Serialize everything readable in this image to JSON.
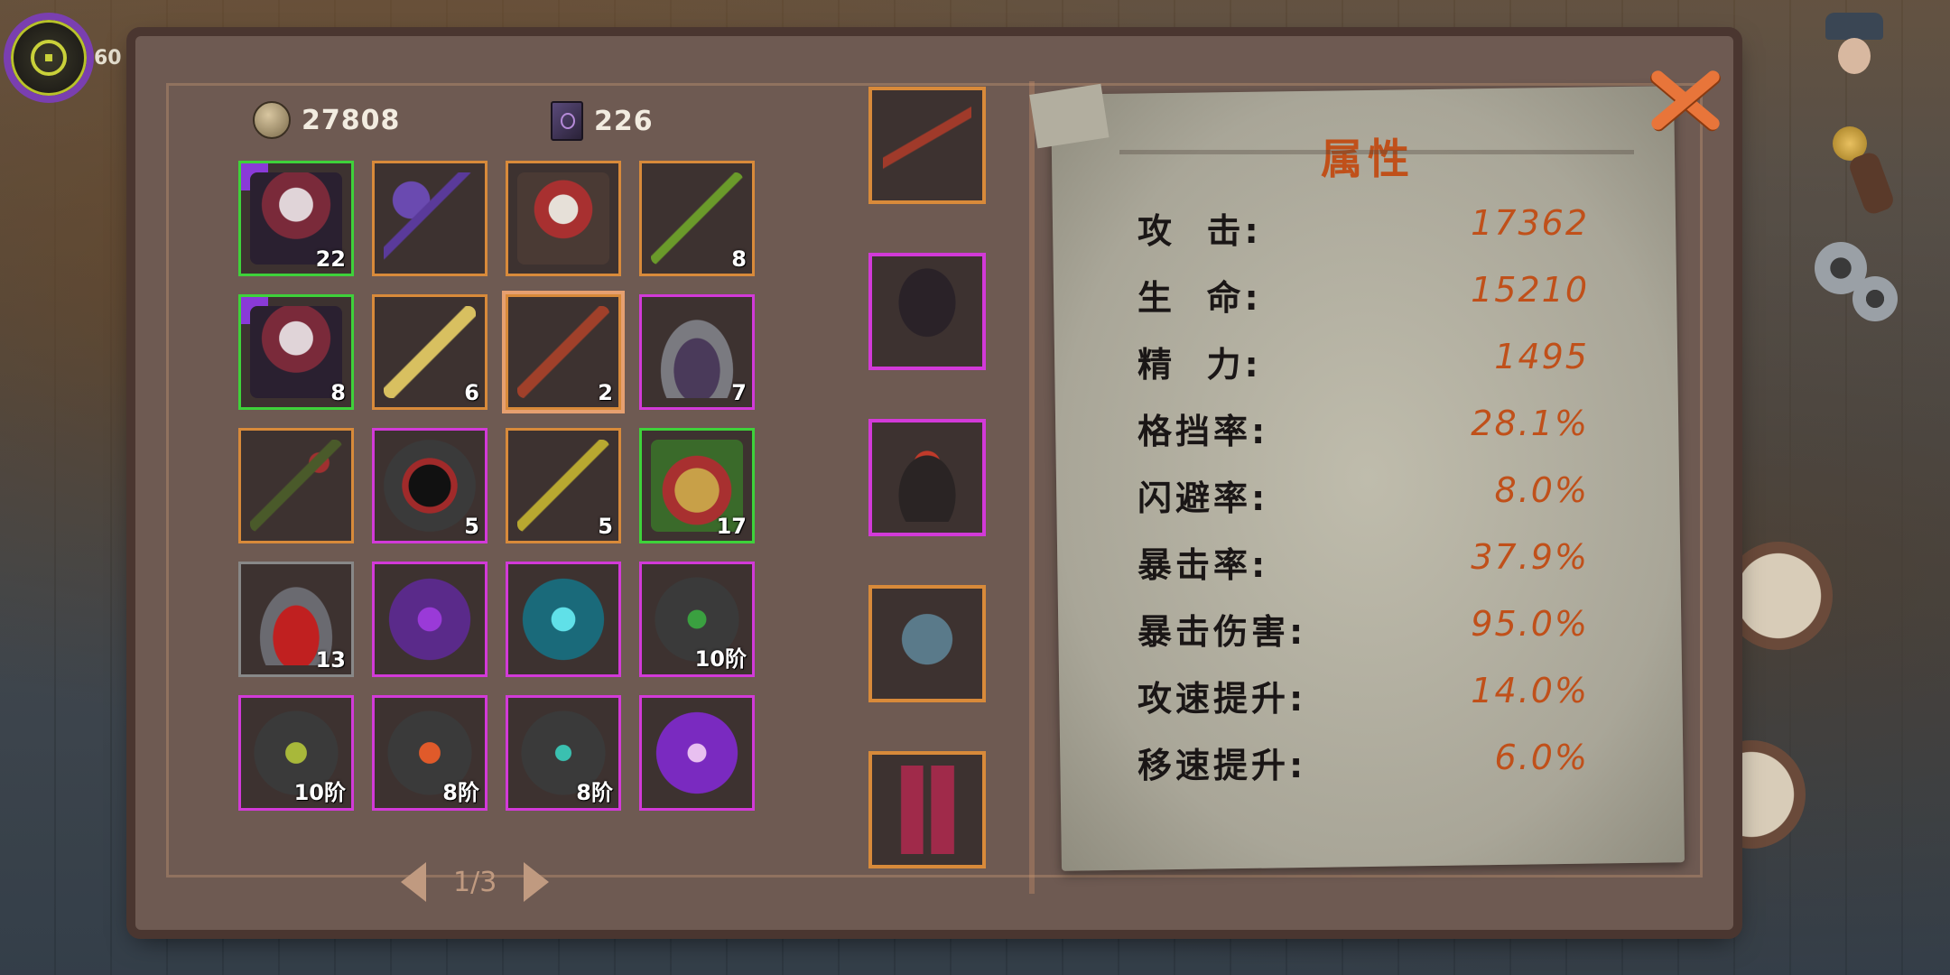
{
  "hud": {
    "level": "60"
  },
  "currency": {
    "coins": "27808",
    "books": "226"
  },
  "inventory": [
    {
      "name": "character-shard-white-hair",
      "count": "22",
      "border": "green",
      "art": "art-char",
      "puzzle": true
    },
    {
      "name": "purple-scythe-scroll",
      "count": "",
      "border": "orange",
      "art": "art-scythe",
      "puzzle": false
    },
    {
      "name": "santa-scroll",
      "count": "",
      "border": "orange",
      "art": "art-santa",
      "puzzle": false
    },
    {
      "name": "green-vine-staff",
      "count": "8",
      "border": "orange",
      "art": "art-vine",
      "puzzle": false
    },
    {
      "name": "character-shard-silver-hair",
      "count": "8",
      "border": "green",
      "art": "art-char",
      "puzzle": true
    },
    {
      "name": "golden-sword-scroll",
      "count": "6",
      "border": "orange",
      "art": "art-sword",
      "puzzle": false
    },
    {
      "name": "red-branch-scroll",
      "count": "2",
      "border": "orange",
      "art": "art-branch",
      "puzzle": false,
      "selected": true
    },
    {
      "name": "dark-potion-jar",
      "count": "7",
      "border": "pink",
      "art": "art-potion-dark",
      "puzzle": false
    },
    {
      "name": "thorn-trident-scroll",
      "count": "",
      "border": "orange",
      "art": "art-trident",
      "puzzle": false
    },
    {
      "name": "void-hole-stone",
      "count": "5",
      "border": "pink",
      "art": "art-hole",
      "puzzle": false
    },
    {
      "name": "golden-spear-scroll",
      "count": "5",
      "border": "orange",
      "art": "art-spear",
      "puzzle": false
    },
    {
      "name": "festive-gift-bell",
      "count": "17",
      "border": "green",
      "art": "art-gift",
      "puzzle": false
    },
    {
      "name": "red-potion-bottle",
      "count": "13",
      "border": "none",
      "art": "art-potion-red",
      "puzzle": false
    },
    {
      "name": "purple-rune",
      "count": "",
      "border": "pink",
      "art": "art-rune-purple",
      "puzzle": false
    },
    {
      "name": "cyan-rune",
      "count": "",
      "border": "pink",
      "art": "art-rune-cyan",
      "puzzle": false
    },
    {
      "name": "green-dagger-stone",
      "count": "10阶",
      "border": "pink",
      "art": "art-stone-green",
      "puzzle": false
    },
    {
      "name": "tree-rune-stone",
      "count": "10阶",
      "border": "pink",
      "art": "art-stone-tree",
      "puzzle": false
    },
    {
      "name": "fang-rune-stone",
      "count": "8阶",
      "border": "pink",
      "art": "art-stone-orange",
      "puzzle": false
    },
    {
      "name": "sword-rune-stone",
      "count": "8阶",
      "border": "pink",
      "art": "art-stone-cyan",
      "puzzle": false
    },
    {
      "name": "mask-rune",
      "count": "",
      "border": "pink",
      "art": "art-mask",
      "puzzle": false
    }
  ],
  "pager": {
    "text": "1/3"
  },
  "equipment": [
    {
      "name": "weapon-slot",
      "border": "orange",
      "art": "art-staff"
    },
    {
      "name": "cloak-slot",
      "border": "pink",
      "art": "art-cloak"
    },
    {
      "name": "hat-slot",
      "border": "pink",
      "art": "art-hat"
    },
    {
      "name": "armor-slot",
      "border": "orange",
      "art": "art-armor"
    },
    {
      "name": "boots-slot",
      "border": "orange",
      "art": "art-boots"
    }
  ],
  "stats": {
    "title": "属性",
    "rows": [
      {
        "label": "攻  击:",
        "value": "17362"
      },
      {
        "label": "生  命:",
        "value": "15210"
      },
      {
        "label": "精  力:",
        "value": "1495"
      },
      {
        "label": "格挡率:",
        "value": "28.1%"
      },
      {
        "label": "闪避率:",
        "value": "8.0%"
      },
      {
        "label": "暴击率:",
        "value": "37.9%"
      },
      {
        "label": "暴击伤害:",
        "value": "95.0%"
      },
      {
        "label": "攻速提升:",
        "value": "14.0%"
      },
      {
        "label": "移速提升:",
        "value": "6.0%"
      }
    ]
  },
  "colors": {
    "accent_orange": "#e8753a",
    "rarity_green": "#3ed23a",
    "rarity_orange": "#d88a3a",
    "rarity_pink": "#d23ad8"
  }
}
